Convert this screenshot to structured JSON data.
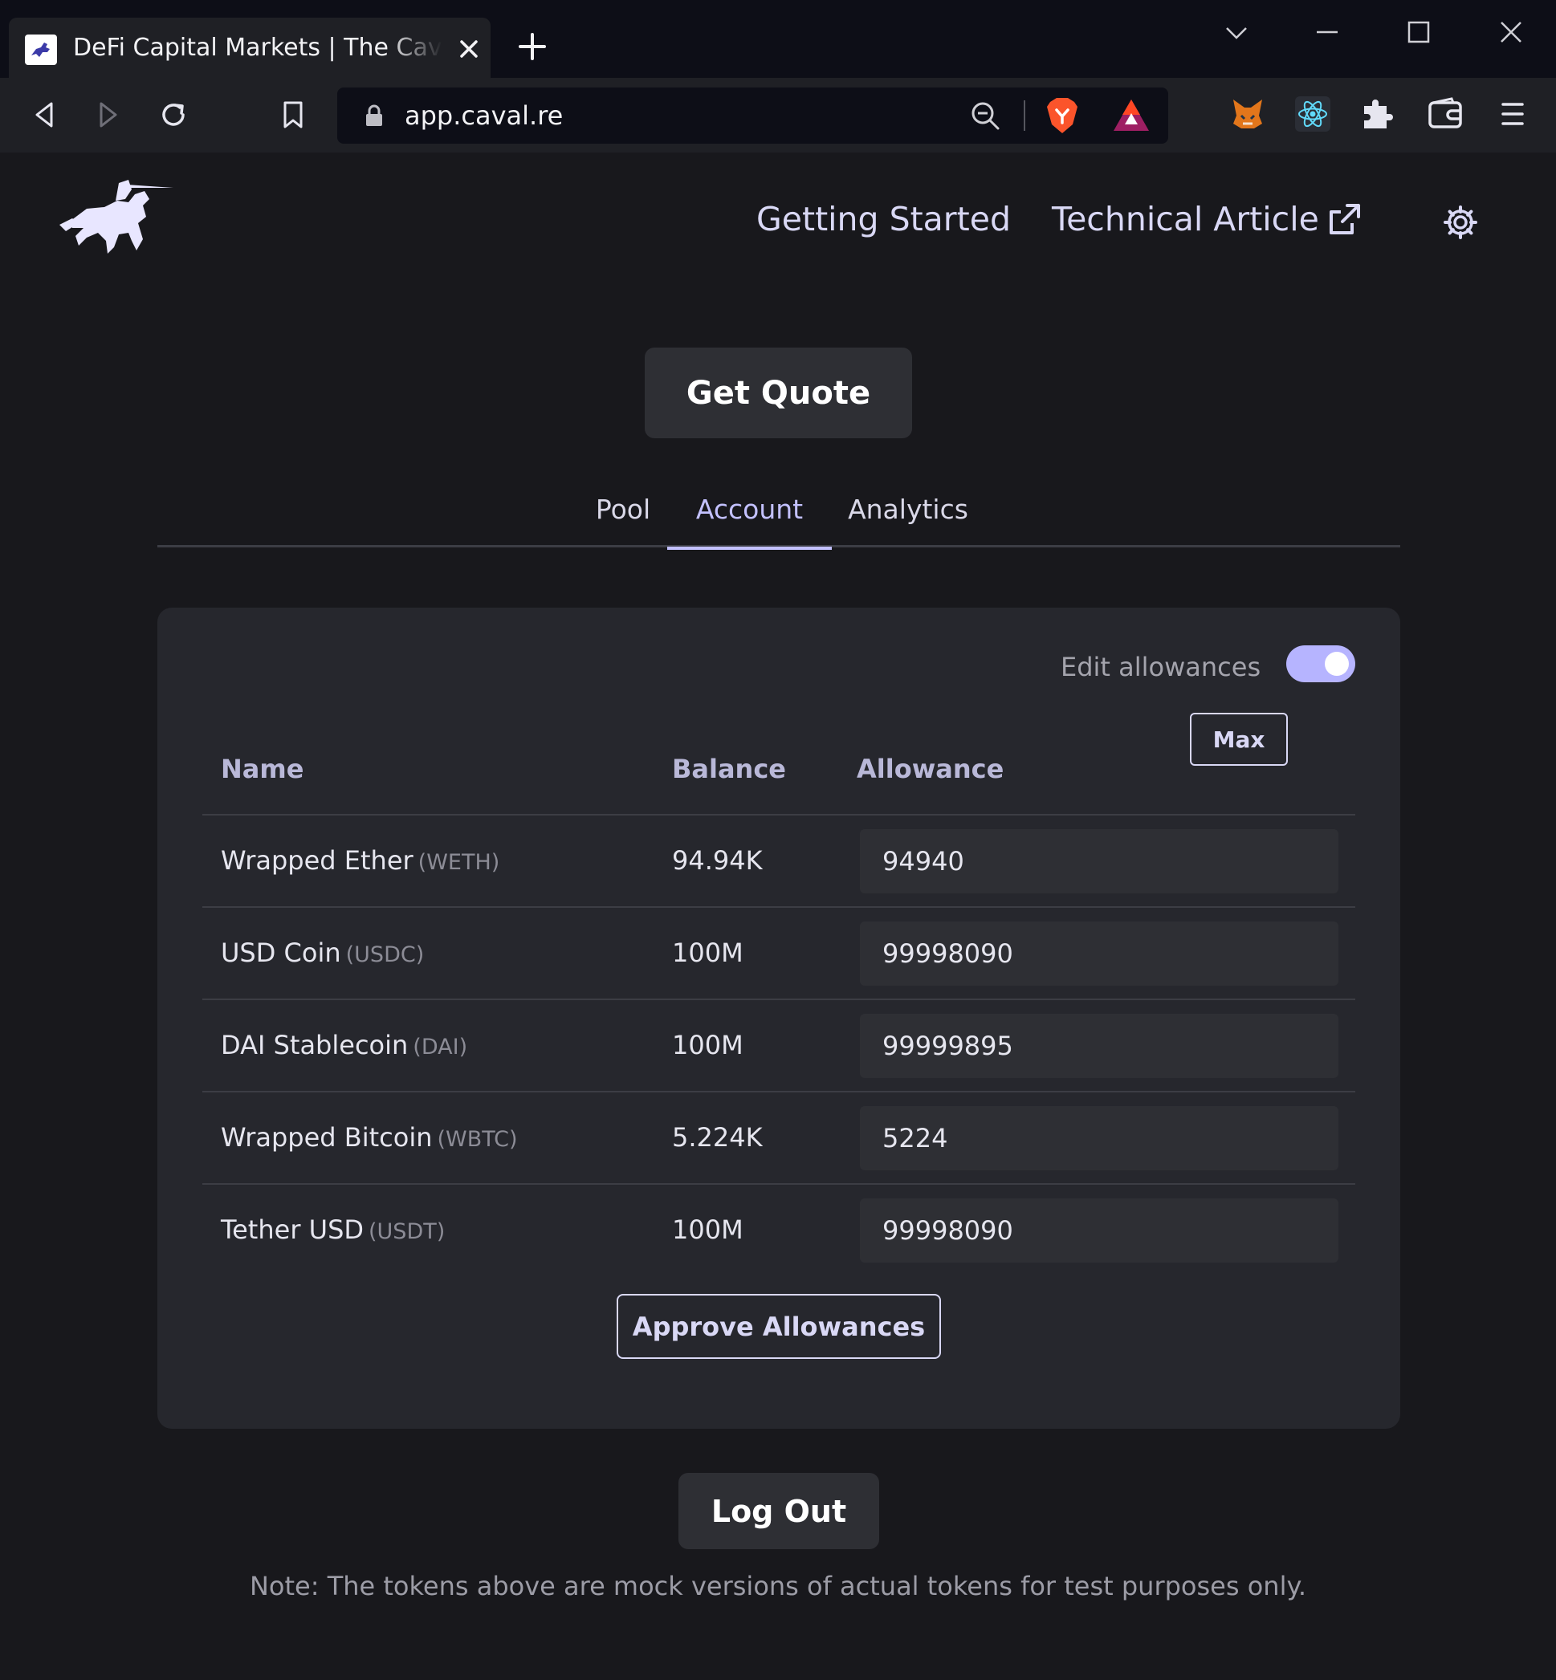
{
  "browser": {
    "tab_title": "DeFi Capital Markets | The CavalRe",
    "url": "app.caval.re",
    "icons": [
      "back-icon",
      "forward-icon",
      "reload-icon",
      "bookmark-icon",
      "lock-icon",
      "zoom-icon",
      "brave-shields-icon",
      "brave-rewards-icon",
      "metamask-icon",
      "react-devtools-icon",
      "extensions-icon",
      "wallet-icon",
      "menu-icon"
    ]
  },
  "header": {
    "nav": {
      "getting_started": "Getting Started",
      "technical_article": "Technical Article"
    },
    "icons": [
      "cavalre-logo",
      "external-link-icon",
      "gear-icon"
    ]
  },
  "main": {
    "get_quote_label": "Get Quote",
    "tabs": [
      {
        "label": "Pool",
        "active": false
      },
      {
        "label": "Account",
        "active": true
      },
      {
        "label": "Analytics",
        "active": false
      }
    ],
    "card": {
      "edit_allowances_label": "Edit allowances",
      "edit_allowances_on": true,
      "columns": {
        "name": "Name",
        "balance": "Balance",
        "allowance": "Allowance"
      },
      "max_label": "Max",
      "rows": [
        {
          "name": "Wrapped Ether",
          "symbol": "(WETH)",
          "balance": "94.94K",
          "allowance": "94940"
        },
        {
          "name": "USD Coin",
          "symbol": "(USDC)",
          "balance": "100M",
          "allowance": "99998090"
        },
        {
          "name": "DAI Stablecoin",
          "symbol": "(DAI)",
          "balance": "100M",
          "allowance": "99999895"
        },
        {
          "name": "Wrapped Bitcoin",
          "symbol": "(WBTC)",
          "balance": "5.224K",
          "allowance": "5224"
        },
        {
          "name": "Tether USD",
          "symbol": "(USDT)",
          "balance": "100M",
          "allowance": "99998090"
        }
      ],
      "approve_label": "Approve Allowances"
    },
    "logout_label": "Log Out",
    "note": "Note: The tokens above are mock versions of actual tokens for test purposes only."
  },
  "colors": {
    "background": "#18181c",
    "card": "#26272d",
    "accent": "#c3c1ff",
    "toggle": "#b6b4ff"
  }
}
